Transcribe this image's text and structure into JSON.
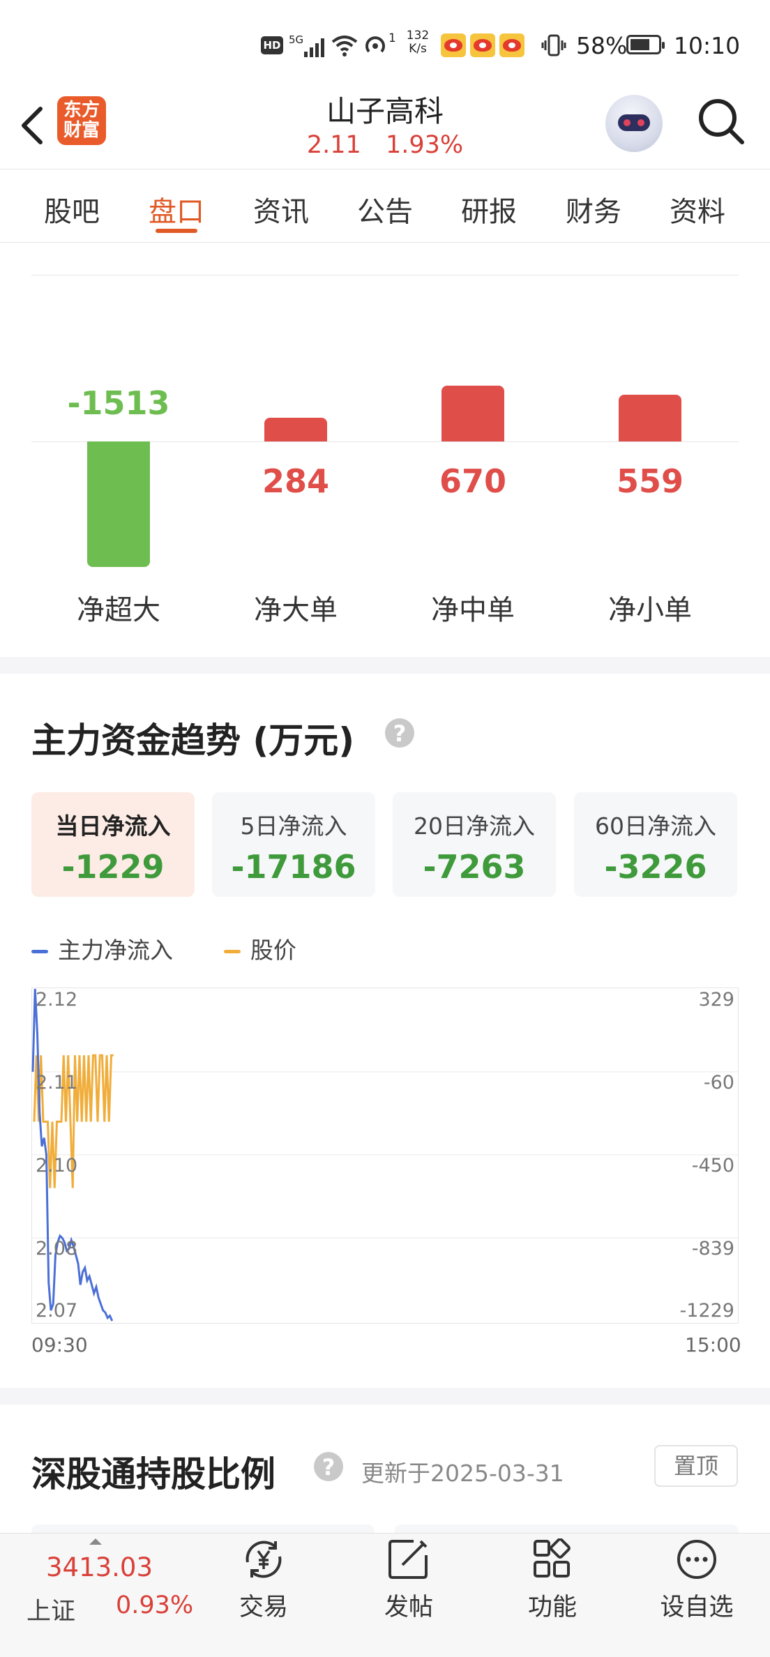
{
  "status_bar": {
    "hd": "HD",
    "net_type": "5G",
    "wifi_suffix": "1",
    "speed_value": "132",
    "speed_unit": "K/s",
    "battery": "58%",
    "time": "10:10"
  },
  "header": {
    "logo_line1": "东方",
    "logo_line2": "财富",
    "stock_name": "山子高科",
    "price": "2.11",
    "change_pct": "1.93%"
  },
  "tabs": [
    "股吧",
    "盘口",
    "资讯",
    "公告",
    "研报",
    "财务",
    "资料"
  ],
  "active_tab": "盘口",
  "fund_flow": [
    {
      "label": "净超大",
      "value": "-1513",
      "amount": -1513,
      "color": "#6ebd50"
    },
    {
      "label": "净大单",
      "value": "284",
      "amount": 284,
      "color": "#e04e4a"
    },
    {
      "label": "净中单",
      "value": "670",
      "amount": 670,
      "color": "#e04e4a"
    },
    {
      "label": "净小单",
      "value": "559",
      "amount": 559,
      "color": "#e04e4a"
    }
  ],
  "trend": {
    "title": "主力资金趋势 (万元)",
    "help": "?",
    "cards": [
      {
        "label": "当日净流入",
        "value": "-1229"
      },
      {
        "label": "5日净流入",
        "value": "-17186"
      },
      {
        "label": "20日净流入",
        "value": "-7263"
      },
      {
        "label": "60日净流入",
        "value": "-3226"
      }
    ],
    "legend": [
      {
        "label": "主力净流入",
        "color": "#4a6fd6"
      },
      {
        "label": "股价",
        "color": "#f0ad3a"
      }
    ],
    "x_start": "09:30",
    "x_end": "15:00"
  },
  "chart_data": {
    "type": "line",
    "x_range": [
      "09:30",
      "15:00"
    ],
    "y_left_ticks": [
      "2.12",
      "2.11",
      "2.10",
      "2.08",
      "2.07"
    ],
    "y_right_ticks": [
      "329",
      "-60",
      "-450",
      "-839",
      "-1229"
    ],
    "y_left_range": [
      2.07,
      2.12
    ],
    "y_right_range": [
      -1229,
      329
    ],
    "series": [
      {
        "name": "主力净流入",
        "color": "#4a6fd6",
        "values": [
          -60,
          329,
          120,
          -250,
          -410,
          -370,
          -450,
          -1050,
          -1180,
          -1150,
          -920,
          -860,
          -830,
          -840,
          -860,
          -900,
          -890,
          -850,
          -880,
          -920,
          -960,
          -1060,
          -1000,
          -980,
          -1040,
          -1020,
          -1060,
          -1100,
          -1070,
          -1120,
          -1150,
          -1180,
          -1190,
          -1215,
          -1205,
          -1229
        ]
      },
      {
        "name": "股价",
        "color": "#f0ad3a",
        "values": [
          2.1,
          2.11,
          2.1,
          2.11,
          2.1,
          2.1,
          2.1,
          2.09,
          2.1,
          2.09,
          2.1,
          2.1,
          2.1,
          2.11,
          2.1,
          2.11,
          2.1,
          2.09,
          2.11,
          2.1,
          2.11,
          2.1,
          2.11,
          2.1,
          2.11,
          2.1,
          2.11,
          2.11,
          2.1,
          2.11,
          2.11,
          2.1,
          2.11,
          2.1,
          2.11,
          2.11
        ]
      }
    ]
  },
  "hk_connect": {
    "title": "深股通持股比例",
    "help": "?",
    "update": "更新于2025-03-31",
    "pin": "置顶"
  },
  "bottom_bar": {
    "index_value": "3413.03",
    "index_name": "上证",
    "index_pct": "0.93%",
    "items": [
      "交易",
      "发帖",
      "功能",
      "设自选"
    ]
  }
}
